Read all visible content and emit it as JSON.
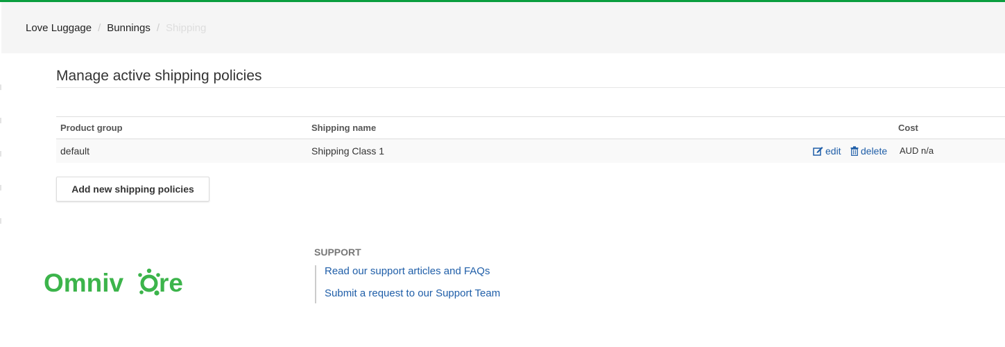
{
  "breadcrumb": {
    "items": [
      "Love Luggage",
      "Bunnings"
    ],
    "current": "Shipping",
    "separator": "/"
  },
  "page": {
    "title": "Manage active shipping policies"
  },
  "table": {
    "headers": {
      "product_group": "Product group",
      "shipping_name": "Shipping name",
      "cost": "Cost"
    },
    "rows": [
      {
        "product_group": "default",
        "shipping_name": "Shipping Class 1",
        "edit_label": "edit",
        "delete_label": "delete",
        "cost": "AUD n/a"
      }
    ]
  },
  "actions": {
    "add_label": "Add new shipping policies"
  },
  "footer": {
    "logo_text": "Omnivore",
    "support_heading": "SUPPORT",
    "links": [
      "Read our support articles and FAQs",
      "Submit a request to our Support Team"
    ]
  },
  "colors": {
    "brand_green": "#3cb44b",
    "top_accent": "#0a9e3f",
    "link_blue": "#1f5ea8"
  },
  "icons": [
    "edit-icon",
    "trash-icon"
  ]
}
